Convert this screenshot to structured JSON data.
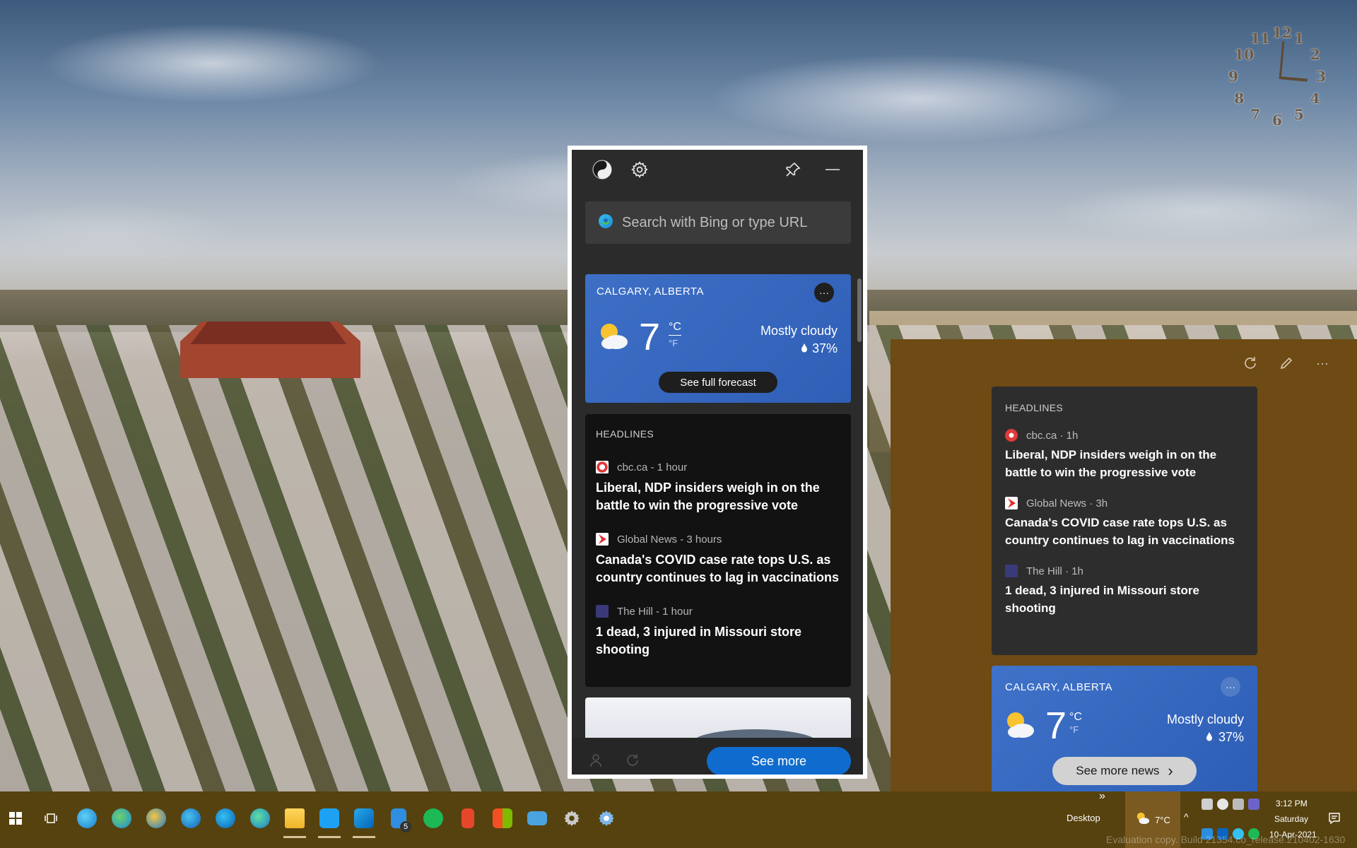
{
  "colors": {
    "taskbar": "#56420f",
    "flyout": "#6e4a14",
    "popup_bg": "#2b2b2b",
    "weather_blue": "#3e6fc6",
    "accent_button": "#0f6cce"
  },
  "desktop": {
    "clock_numbers": [
      "12",
      "1",
      "2",
      "3",
      "4",
      "5",
      "6",
      "7",
      "8",
      "9",
      "10",
      "11"
    ]
  },
  "popup": {
    "toolbar": {
      "theme_icon": "yin-yang-icon",
      "settings_icon": "gear-icon",
      "pin_icon": "pin-icon",
      "minimize_icon": "minimize-icon"
    },
    "search": {
      "placeholder": "Search with Bing or type URL",
      "icon": "edge-icon"
    },
    "weather": {
      "city": "CALGARY, ALBERTA",
      "temp": "7",
      "unit_c": "°C",
      "unit_f": "°F",
      "condition": "Mostly cloudy",
      "precip": "37%",
      "forecast_button": "See full forecast",
      "more": "···"
    },
    "headlines": {
      "title": "HEADLINES",
      "items": [
        {
          "source": "cbc.ca - 1 hour",
          "text": "Liberal, NDP insiders weigh in on the battle to win the progressive vote"
        },
        {
          "source": "Global News - 3 hours",
          "text": "Canada's COVID case rate tops U.S. as country continues to lag in vaccinations"
        },
        {
          "source": "The Hill - 1 hour",
          "text": "1 dead, 3 injured in Missouri store shooting"
        }
      ]
    },
    "see_more": "See more"
  },
  "flyout": {
    "headlines": {
      "title": "HEADLINES",
      "items": [
        {
          "source": "cbc.ca · 1h",
          "text": "Liberal, NDP insiders weigh in on the battle to win the progressive vote"
        },
        {
          "source": "Global News · 3h",
          "text": "Canada's COVID case rate tops U.S. as country continues to lag in vaccinations"
        },
        {
          "source": "The Hill · 1h",
          "text": "1 dead, 3 injured in Missouri store shooting"
        }
      ]
    },
    "weather": {
      "city": "CALGARY, ALBERTA",
      "temp": "7",
      "unit_c": "°C",
      "unit_f": "°F",
      "condition": "Mostly cloudy",
      "precip": "37%",
      "more": "···",
      "see_more_news": "See more news",
      "chevron": "›"
    }
  },
  "taskbar": {
    "desktop_label": "Desktop",
    "weather_temp": "7°C",
    "overflow_chevrons": "»",
    "tray_chevron": "^",
    "time": "3:12 PM",
    "day": "Saturday",
    "date": "10-Apr-2021",
    "outlook_badge": "5",
    "watermark": "Evaluation copy. Build 21354.co_release.210402-1630"
  }
}
